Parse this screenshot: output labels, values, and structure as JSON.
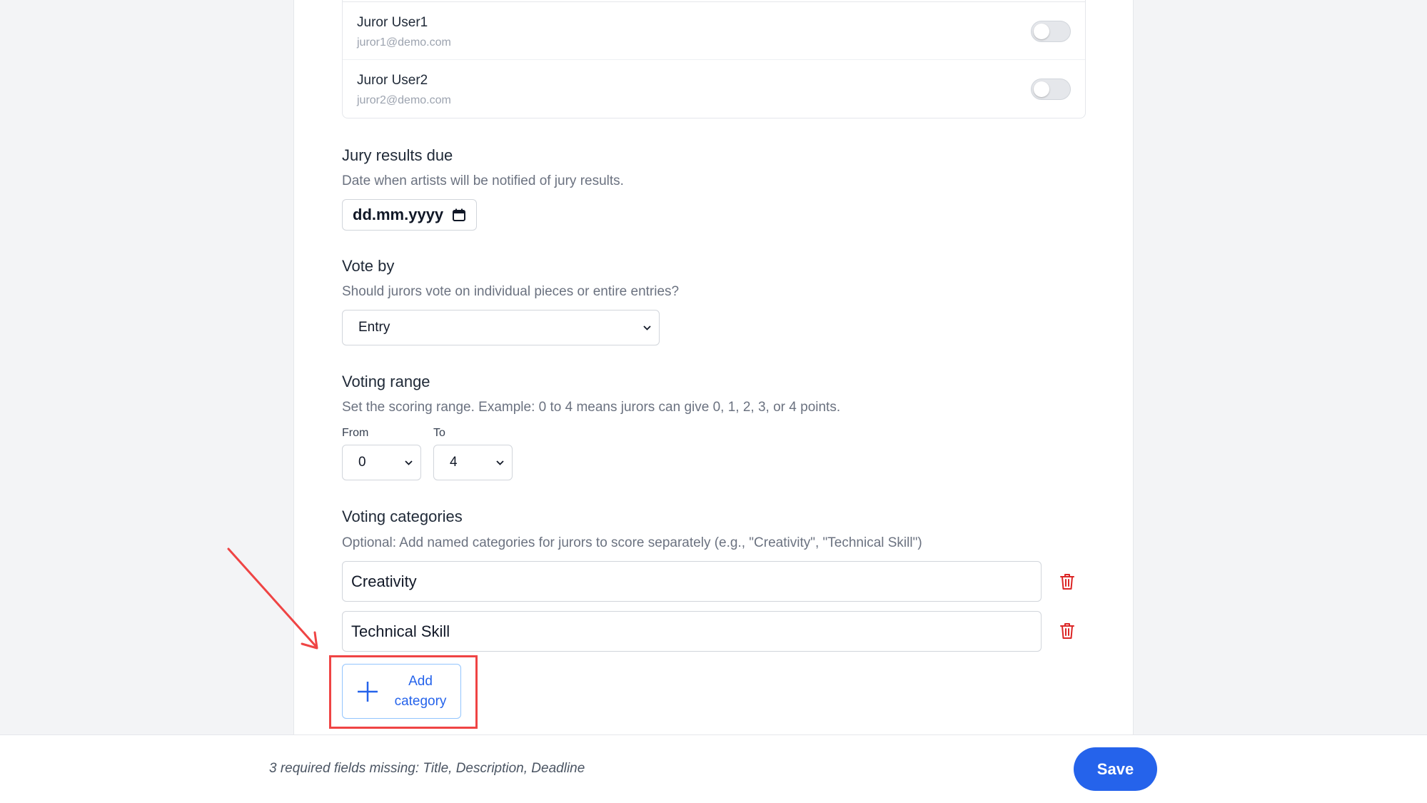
{
  "jurors": [
    {
      "name": "Juror User1",
      "email": "juror1@demo.com",
      "enabled": false
    },
    {
      "name": "Juror User2",
      "email": "juror2@demo.com",
      "enabled": false
    }
  ],
  "jury_results": {
    "title": "Jury results due",
    "description": "Date when artists will be notified of jury results.",
    "date_placeholder": "dd.mm.yyyy"
  },
  "vote_by": {
    "title": "Vote by",
    "description": "Should jurors vote on individual pieces or entire entries?",
    "selected": "Entry"
  },
  "voting_range": {
    "title": "Voting range",
    "description": "Set the scoring range. Example: 0 to 4 means jurors can give 0, 1, 2, 3, or 4 points.",
    "from_label": "From",
    "from_value": "0",
    "to_label": "To",
    "to_value": "4"
  },
  "voting_categories": {
    "title": "Voting categories",
    "description": "Optional: Add named categories for jurors to score separately (e.g., \"Creativity\", \"Technical Skill\")",
    "items": [
      "Creativity",
      "Technical Skill"
    ],
    "add_label_line1": "Add",
    "add_label_line2": "category"
  },
  "footer": {
    "message": "3 required fields missing: Title, Description, Deadline",
    "save_label": "Save"
  },
  "colors": {
    "accent": "#2563eb",
    "danger": "#dc2626",
    "annotation": "#ef4444"
  },
  "icons": [
    "calendar-icon",
    "chevron-down-icon",
    "trash-icon",
    "plus-icon",
    "annotation-arrow"
  ]
}
